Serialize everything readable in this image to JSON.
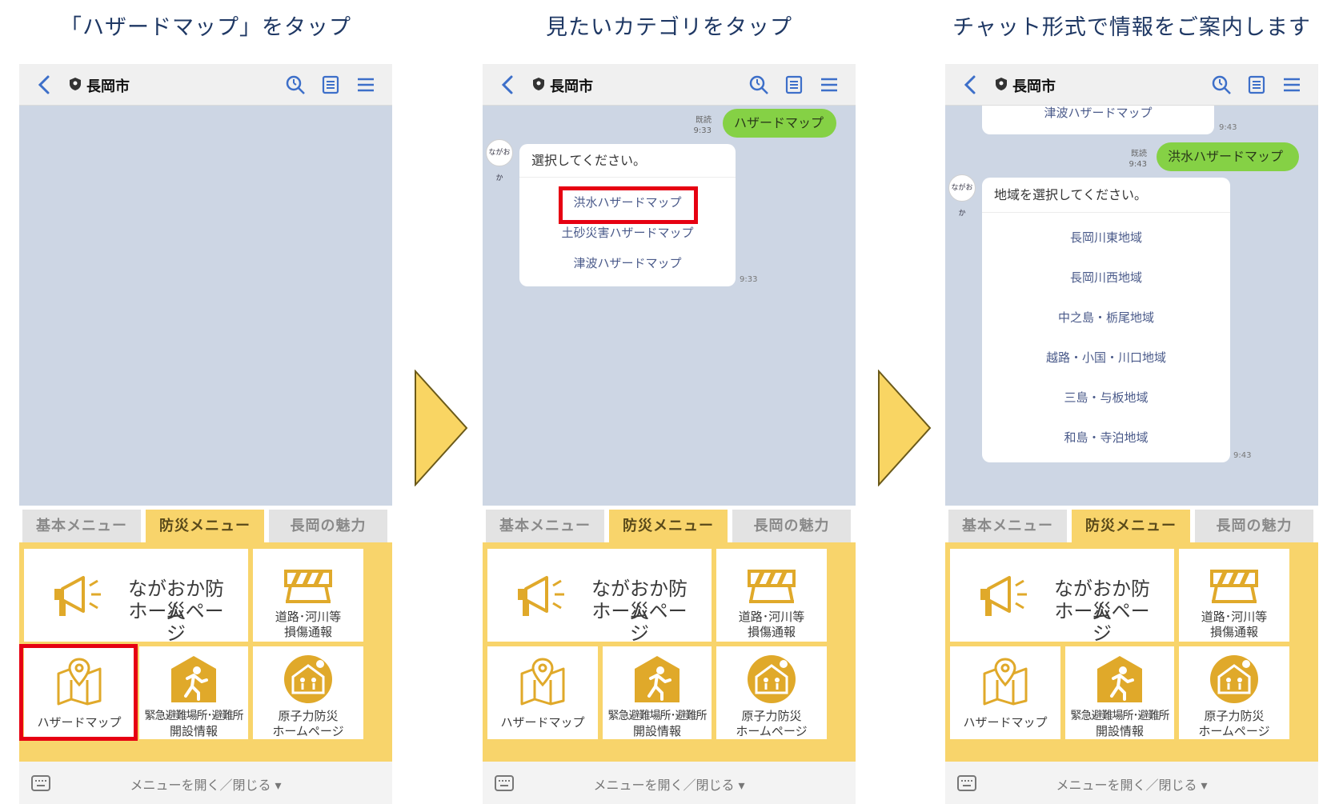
{
  "step_titles": [
    "「ハザードマップ」をタップ",
    "見たいカテゴリをタップ",
    "チャット形式で情報をご案内します"
  ],
  "header": {
    "title": "長岡市"
  },
  "tabs": [
    "基本メニュー",
    "防災メニュー",
    "長岡の魅力"
  ],
  "menu": {
    "bosai_home": [
      "ながおか防災",
      "ホームページ"
    ],
    "road_report": [
      "道路･河川等",
      "損傷通報"
    ],
    "hazard_map": "ハザードマップ",
    "evacuation": [
      "緊急避難場所･避難所",
      "開設情報"
    ],
    "nuclear": [
      "原子力防災",
      "ホームページ"
    ]
  },
  "bottom_bar": "メニューを開く／閉じる ▾",
  "avatar_text": "ながおか",
  "screen2": {
    "read_label": "既読",
    "sent_time": "9:33",
    "user_message": "ハザードマップ",
    "prompt": "選択してください。",
    "options": [
      "洪水ハザードマップ",
      "土砂災害ハザードマップ",
      "津波ハザードマップ"
    ],
    "reply_time": "9:33"
  },
  "screen3": {
    "prev_option": "津波ハザードマップ",
    "prev_time": "9:43",
    "read_label": "既読",
    "sent_time": "9:43",
    "user_message": "洪水ハザードマップ",
    "prompt": "地域を選択してください。",
    "options": [
      "長岡川東地域",
      "長岡川西地域",
      "中之島・栃尾地域",
      "越路・小国・川口地域",
      "三島・与板地域",
      "和島・寺泊地域"
    ],
    "reply_time": "9:43"
  },
  "colors": {
    "accent_yellow": "#f8d46b",
    "user_bubble": "#85d145",
    "chat_bg": "#cdd6e4",
    "highlight_red": "#e60012",
    "arrow": "#f9d563"
  }
}
